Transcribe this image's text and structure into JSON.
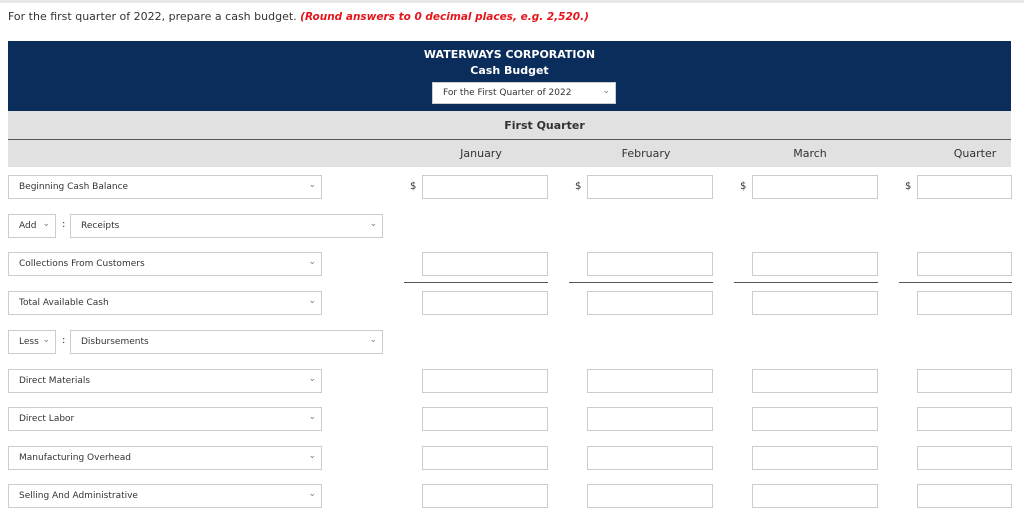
{
  "instruction": "For the first quarter of 2022, prepare a cash budget.",
  "instruction_note": "(Round answers to 0 decimal places, e.g. 2,520.)",
  "header": {
    "company": "WATERWAYS CORPORATION",
    "title": "Cash Budget",
    "period_select": "For the First Quarter of 2022"
  },
  "group_header": "First Quarter",
  "columns": [
    "January",
    "February",
    "March",
    "Quarter"
  ],
  "currency": "$",
  "rows": {
    "beginning": "Beginning Cash Balance",
    "add_op": "Add",
    "receipts": "Receipts",
    "collections": "Collections From Customers",
    "total_available": "Total Available Cash",
    "less_op": "Less",
    "disbursements": "Disbursements",
    "direct_materials": "Direct Materials",
    "direct_labor": "Direct Labor",
    "mfg_overhead": "Manufacturing Overhead",
    "selling_admin": "Selling And Administrative"
  },
  "colors": {
    "header_bg": "#0b2d5b",
    "band_bg": "#e1e1e1",
    "note": "#e4161b"
  }
}
